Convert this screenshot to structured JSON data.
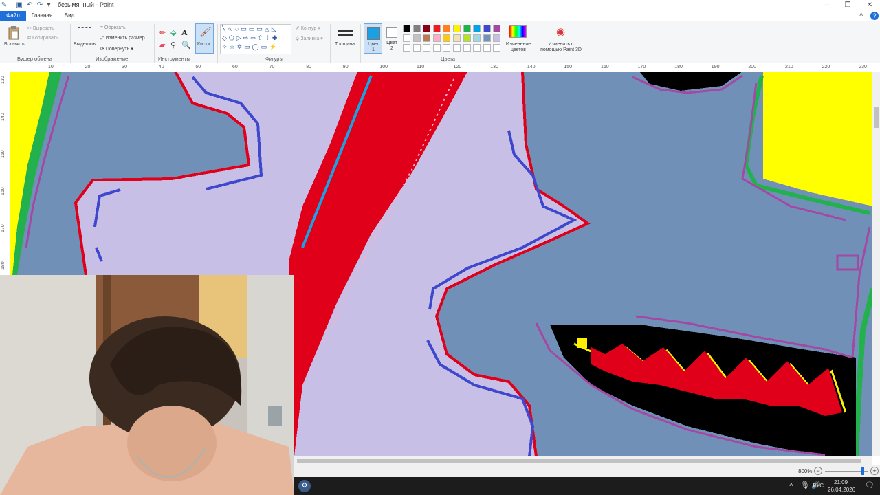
{
  "window": {
    "title": "безымянный - Paint",
    "controls": [
      "minimize",
      "maximize",
      "close"
    ]
  },
  "tabs": {
    "file": "Файл",
    "home": "Главная",
    "view": "Вид"
  },
  "ribbon": {
    "clipboard": {
      "paste": "Вставить",
      "cut": "Вырезать",
      "copy": "Копировать",
      "title": "Буфер обмена"
    },
    "image": {
      "select": "Выделить",
      "crop": "Обрезать",
      "resize": "Изменить размер",
      "rotate": "Повернуть",
      "title": "Изображение"
    },
    "tools": {
      "brushes": "Кисти",
      "title": "Инструменты"
    },
    "shapes": {
      "outline": "Контур",
      "fill": "Заливка",
      "title": "Фигуры"
    },
    "size": {
      "label": "Толщина"
    },
    "colors": {
      "color1": "Цвет 1",
      "color2": "Цвет 2",
      "edit_colors": "Изменение цветов",
      "paint3d": "Изменить с помощью Paint 3D",
      "title": "Цвета",
      "color1_value": "#1ba1e2",
      "color2_value": "#ffffff",
      "palette_row1": [
        "#000000",
        "#7f7f7f",
        "#880015",
        "#ed1c24",
        "#ff7f27",
        "#fff200",
        "#22b14c",
        "#00a2e8",
        "#3f48cc",
        "#a349a4"
      ],
      "palette_row2": [
        "#ffffff",
        "#c3c3c3",
        "#b97a57",
        "#ffaec9",
        "#ffc90e",
        "#efe4b0",
        "#b5e61d",
        "#99d9ea",
        "#7092be",
        "#c8bfe7"
      ]
    }
  },
  "ruler": {
    "top_ticks": [
      "10",
      "20",
      "30",
      "40",
      "50",
      "60",
      "70",
      "80",
      "90",
      "100",
      "110",
      "120",
      "130",
      "140",
      "150",
      "160",
      "170",
      "180",
      "190",
      "200",
      "210",
      "220",
      "230"
    ],
    "left_ticks": [
      "130",
      "140",
      "150",
      "160",
      "170",
      "180"
    ]
  },
  "status": {
    "zoom": "800%"
  },
  "taskbar": {
    "language": "РУС",
    "time": "21:09",
    "date": "26.04.2026"
  }
}
